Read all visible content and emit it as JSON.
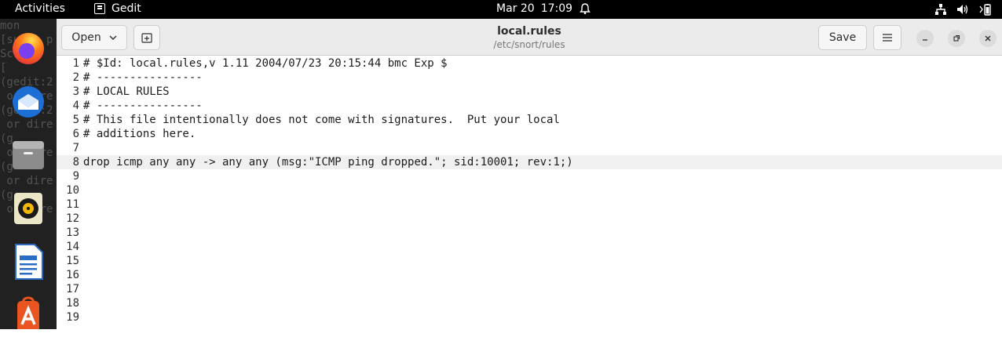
{
  "topbar": {
    "activities": "Activities",
    "app_name": "Gedit",
    "date": "Mar 20",
    "time": "17:09"
  },
  "background_terminal": {
    "lines": [
      "",
      "mon",
      "[sudo] p",
      "Sc",
      "[",
      "",
      "",
      "(gedit:2",
      " or dire",
      "",
      "(gedit:2",
      " or dire",
      "",
      "(g",
      " or dire",
      "",
      "(g",
      " or dire",
      "",
      "(g",
      " or dire"
    ]
  },
  "dock": {
    "items": [
      "firefox-icon",
      "thunderbird-icon",
      "files-icon",
      "rhythmbox-icon",
      "libreoffice-writer-icon",
      "app-center-icon"
    ]
  },
  "window": {
    "open_label": "Open",
    "save_label": "Save",
    "title": "local.rules",
    "subtitle": "/etc/snort/rules"
  },
  "editor": {
    "current_line": 8,
    "lines": [
      {
        "n": "1",
        "text": "# $Id: local.rules,v 1.11 2004/07/23 20:15:44 bmc Exp $"
      },
      {
        "n": "2",
        "text": "# ----------------"
      },
      {
        "n": "3",
        "text": "# LOCAL RULES"
      },
      {
        "n": "4",
        "text": "# ----------------"
      },
      {
        "n": "5",
        "text": "# This file intentionally does not come with signatures.  Put your local"
      },
      {
        "n": "6",
        "text": "# additions here."
      },
      {
        "n": "7",
        "text": ""
      },
      {
        "n": "8",
        "text": "drop icmp any any -> any any (msg:\"ICMP ping dropped.\"; sid:10001; rev:1;)"
      },
      {
        "n": "9",
        "text": ""
      },
      {
        "n": "10",
        "text": ""
      },
      {
        "n": "11",
        "text": ""
      },
      {
        "n": "12",
        "text": ""
      },
      {
        "n": "13",
        "text": ""
      },
      {
        "n": "14",
        "text": ""
      },
      {
        "n": "15",
        "text": ""
      },
      {
        "n": "16",
        "text": ""
      },
      {
        "n": "17",
        "text": ""
      },
      {
        "n": "18",
        "text": ""
      },
      {
        "n": "19",
        "text": ""
      }
    ]
  }
}
